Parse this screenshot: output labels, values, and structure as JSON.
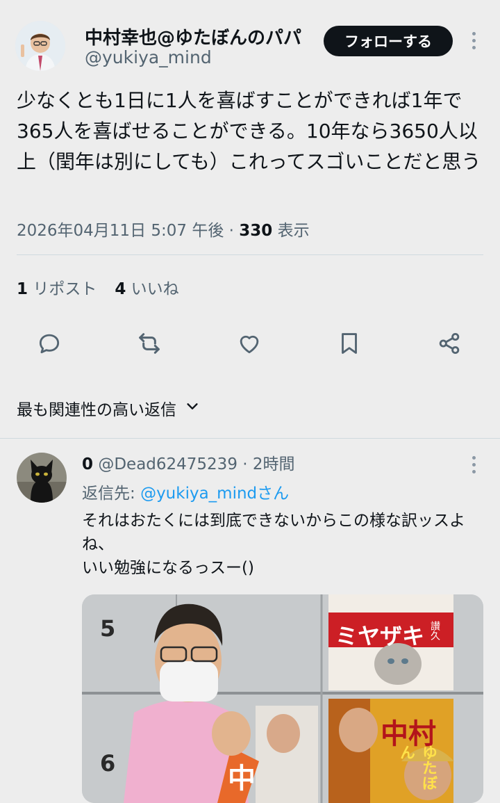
{
  "tweet": {
    "author_name": "中村幸也@ゆたぼんのパパ",
    "author_handle": "@yukiya_mind",
    "follow_label": "フォローする",
    "text": "少なくとも1日に1人を喜ばすことができれば1年で365人を喜ばせることができる。10年なら3650人以上（閏年は別にしても）これってスゴいことだと思う",
    "timestamp": "2026年04月11日 5:07 午後",
    "separator": " · ",
    "views_count": "330",
    "views_label": " 表示",
    "reposts_count": "1",
    "reposts_label": " リポスト",
    "likes_count": "4",
    "likes_label": " いいね"
  },
  "actions": {
    "icons": [
      "reply-icon",
      "repost-icon",
      "like-icon",
      "bookmark-icon",
      "share-icon"
    ]
  },
  "sort": {
    "label": "最も関連性の高い返信"
  },
  "reply": {
    "author_name": "0",
    "author_handle": " @Dead62475239",
    "time": " · 2時間",
    "reply_to_prefix": "返信先: ",
    "reply_to_handle": "@yukiya_mindさん",
    "text": "それはおたくには到底できないからこの様な訳ッスよね、\nいい勉強になるっスー()",
    "media_texts": {
      "number_top": "5",
      "number_bottom": "6",
      "poster_top_name": "ミヤザキ",
      "poster_top_small": "讃久",
      "poster_bottom_name": "中村",
      "poster_bottom_sub": "ゆたぼん",
      "sash_text": "中"
    }
  },
  "colors": {
    "background": "#ededed",
    "text": "#0f1419",
    "secondary": "#536471",
    "link": "#1d9bf0",
    "divider": "#cfd9de",
    "follow_bg": "#0f1419"
  }
}
